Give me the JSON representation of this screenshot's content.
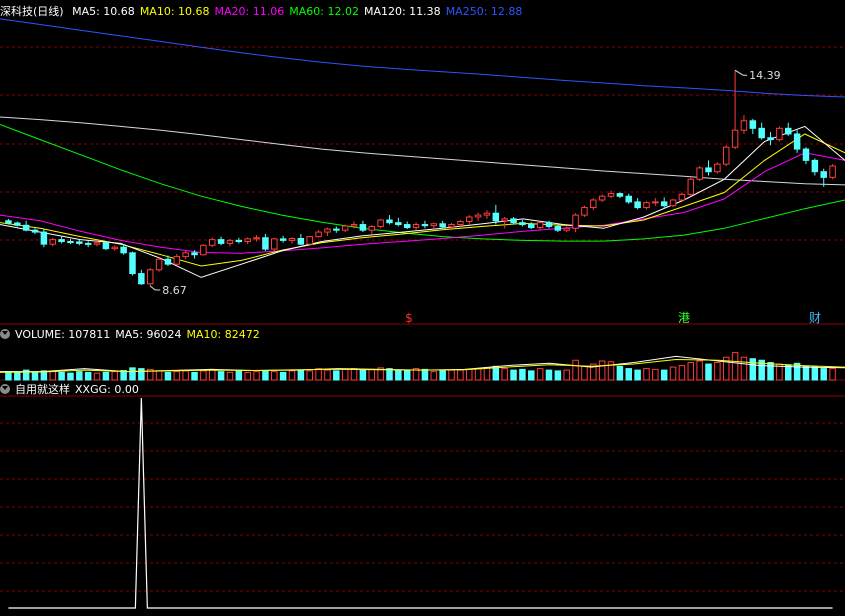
{
  "price_header": {
    "title": "深科技(日线)",
    "items": [
      {
        "label": "MA5: 10.68",
        "color": "#ffffff"
      },
      {
        "label": "MA10: 10.68",
        "color": "#ffff00"
      },
      {
        "label": "MA20: 11.06",
        "color": "#ff00ff"
      },
      {
        "label": "MA60: 12.02",
        "color": "#00ff00"
      },
      {
        "label": "MA120: 11.38",
        "color": "#ffffff"
      },
      {
        "label": "MA250: 12.88",
        "color": "#2e55ff"
      }
    ]
  },
  "volume_header": {
    "items": [
      {
        "label": "VOLUME: 107811",
        "color": "#ffffff"
      },
      {
        "label": "MA5: 96024",
        "color": "#ffffff"
      },
      {
        "label": "MA10: 82472",
        "color": "#ffff00"
      }
    ]
  },
  "indicator_header": {
    "items": [
      {
        "label": "自用就这样",
        "color": "#ffffff"
      },
      {
        "label": "XXGG: 0.00",
        "color": "#ffffff"
      }
    ]
  },
  "annotations": {
    "high_label": "14.39",
    "low_label": "8.67"
  },
  "event_markers": [
    {
      "label": "$",
      "color": "#ff3030"
    },
    {
      "label": "港",
      "color": "#30ff30"
    },
    {
      "label": "财",
      "color": "#3fb8ff"
    }
  ],
  "colors": {
    "up": "#ff3c3c",
    "down": "#54ffff",
    "grid": "#8b0000",
    "background": "#000000"
  },
  "chart_data": [
    {
      "type": "candlestick",
      "title": "深科技(日线)",
      "ylim": [
        8.3,
        15.8
      ],
      "x_index": "trading day index 0-93",
      "candles_ohlc": [
        [
          10.4,
          10.45,
          10.3,
          10.34
        ],
        [
          10.34,
          10.38,
          10.25,
          10.28
        ],
        [
          10.28,
          10.4,
          10.12,
          10.15
        ],
        [
          10.15,
          10.2,
          10.05,
          10.1
        ],
        [
          10.1,
          10.18,
          9.7,
          9.78
        ],
        [
          9.78,
          9.95,
          9.72,
          9.9
        ],
        [
          9.9,
          9.98,
          9.8,
          9.85
        ],
        [
          9.85,
          9.92,
          9.78,
          9.84
        ],
        [
          9.84,
          9.9,
          9.75,
          9.8
        ],
        [
          9.8,
          9.86,
          9.7,
          9.78
        ],
        [
          9.78,
          9.88,
          9.72,
          9.82
        ],
        [
          9.82,
          9.86,
          9.62,
          9.66
        ],
        [
          9.66,
          9.75,
          9.6,
          9.7
        ],
        [
          9.7,
          9.78,
          9.5,
          9.55
        ],
        [
          9.55,
          9.58,
          8.95,
          9.0
        ],
        [
          9.0,
          9.1,
          8.7,
          8.73
        ],
        [
          8.73,
          9.15,
          8.67,
          9.1
        ],
        [
          9.1,
          9.42,
          9.05,
          9.38
        ],
        [
          9.38,
          9.48,
          9.2,
          9.25
        ],
        [
          9.25,
          9.52,
          9.22,
          9.45
        ],
        [
          9.45,
          9.6,
          9.38,
          9.55
        ],
        [
          9.55,
          9.62,
          9.4,
          9.5
        ],
        [
          9.5,
          9.78,
          9.48,
          9.75
        ],
        [
          9.75,
          9.95,
          9.7,
          9.9
        ],
        [
          9.9,
          9.98,
          9.75,
          9.8
        ],
        [
          9.8,
          9.92,
          9.72,
          9.88
        ],
        [
          9.88,
          9.95,
          9.8,
          9.85
        ],
        [
          9.85,
          9.96,
          9.78,
          9.92
        ],
        [
          9.92,
          10.02,
          9.85,
          9.95
        ],
        [
          9.95,
          10.05,
          9.6,
          9.65
        ],
        [
          9.65,
          9.95,
          9.6,
          9.92
        ],
        [
          9.92,
          10.0,
          9.82,
          9.88
        ],
        [
          9.88,
          9.96,
          9.8,
          9.93
        ],
        [
          9.93,
          10.05,
          9.75,
          9.78
        ],
        [
          9.78,
          10.0,
          9.75,
          9.98
        ],
        [
          9.98,
          10.15,
          9.95,
          10.1
        ],
        [
          10.1,
          10.22,
          10.0,
          10.18
        ],
        [
          10.18,
          10.25,
          10.08,
          10.15
        ],
        [
          10.15,
          10.3,
          10.1,
          10.26
        ],
        [
          10.26,
          10.38,
          10.2,
          10.3
        ],
        [
          10.3,
          10.4,
          10.1,
          10.15
        ],
        [
          10.15,
          10.28,
          10.05,
          10.25
        ],
        [
          10.25,
          10.45,
          10.2,
          10.42
        ],
        [
          10.42,
          10.55,
          10.3,
          10.35
        ],
        [
          10.35,
          10.48,
          10.25,
          10.3
        ],
        [
          10.3,
          10.38,
          10.18,
          10.22
        ],
        [
          10.22,
          10.36,
          10.15,
          10.3
        ],
        [
          10.3,
          10.4,
          10.2,
          10.27
        ],
        [
          10.27,
          10.35,
          10.18,
          10.32
        ],
        [
          10.32,
          10.4,
          10.2,
          10.24
        ],
        [
          10.24,
          10.34,
          10.15,
          10.3
        ],
        [
          10.3,
          10.42,
          10.22,
          10.38
        ],
        [
          10.38,
          10.55,
          10.3,
          10.5
        ],
        [
          10.5,
          10.62,
          10.4,
          10.55
        ],
        [
          10.55,
          10.68,
          10.45,
          10.6
        ],
        [
          10.6,
          10.82,
          10.3,
          10.4
        ],
        [
          10.4,
          10.5,
          10.2,
          10.45
        ],
        [
          10.45,
          10.5,
          10.3,
          10.35
        ],
        [
          10.35,
          10.42,
          10.25,
          10.3
        ],
        [
          10.3,
          10.36,
          10.18,
          10.22
        ],
        [
          10.22,
          10.38,
          10.15,
          10.35
        ],
        [
          10.35,
          10.4,
          10.2,
          10.25
        ],
        [
          10.25,
          10.3,
          10.1,
          10.15
        ],
        [
          10.15,
          10.25,
          10.1,
          10.2
        ],
        [
          10.2,
          10.6,
          10.1,
          10.55
        ],
        [
          10.55,
          10.8,
          10.5,
          10.75
        ],
        [
          10.75,
          11.0,
          10.68,
          10.95
        ],
        [
          10.95,
          11.1,
          10.9,
          11.05
        ],
        [
          11.05,
          11.2,
          11.0,
          11.12
        ],
        [
          11.12,
          11.15,
          11.0,
          11.05
        ],
        [
          11.05,
          11.12,
          10.85,
          10.9
        ],
        [
          10.9,
          11.0,
          10.7,
          10.75
        ],
        [
          10.75,
          10.92,
          10.7,
          10.88
        ],
        [
          10.88,
          11.0,
          10.8,
          10.9
        ],
        [
          10.9,
          11.02,
          10.75,
          10.8
        ],
        [
          10.8,
          10.98,
          10.76,
          10.95
        ],
        [
          10.95,
          11.15,
          10.9,
          11.1
        ],
        [
          11.1,
          11.55,
          11.05,
          11.5
        ],
        [
          11.5,
          11.85,
          11.45,
          11.8
        ],
        [
          11.8,
          12.0,
          11.6,
          11.7
        ],
        [
          11.7,
          11.95,
          11.65,
          11.9
        ],
        [
          11.9,
          12.4,
          11.85,
          12.35
        ],
        [
          12.35,
          14.39,
          12.3,
          12.8
        ],
        [
          12.8,
          13.2,
          12.7,
          13.05
        ],
        [
          13.05,
          13.1,
          12.7,
          12.85
        ],
        [
          12.85,
          13.0,
          12.55,
          12.6
        ],
        [
          12.6,
          12.75,
          12.4,
          12.55
        ],
        [
          12.55,
          12.9,
          12.5,
          12.85
        ],
        [
          12.85,
          13.0,
          12.65,
          12.7
        ],
        [
          12.7,
          12.8,
          12.2,
          12.3
        ],
        [
          12.3,
          12.35,
          11.9,
          12.0
        ],
        [
          12.0,
          12.05,
          11.6,
          11.7
        ],
        [
          11.7,
          11.78,
          11.3,
          11.55
        ],
        [
          11.55,
          11.9,
          11.5,
          11.85
        ]
      ],
      "ma_series": [
        {
          "name": "MA120",
          "color": "#d8d8d8",
          "values": [
            13.15,
            13.08,
            13.0,
            12.9,
            12.8,
            12.68,
            12.55,
            12.42,
            12.3,
            12.2,
            12.12,
            12.04,
            11.96,
            11.88,
            11.8,
            11.72,
            11.65,
            11.58,
            11.5,
            11.44,
            11.38,
            11.35
          ]
        },
        {
          "name": "MA250",
          "color": "#2e55ff",
          "values": [
            15.75,
            15.6,
            15.45,
            15.3,
            15.15,
            15.0,
            14.85,
            14.72,
            14.6,
            14.5,
            14.42,
            14.35,
            14.28,
            14.2,
            14.12,
            14.05,
            13.98,
            13.92,
            13.86,
            13.78,
            13.72,
            13.68
          ]
        },
        {
          "name": "MA60",
          "color": "#00ff00",
          "values": [
            12.95,
            12.55,
            12.15,
            11.75,
            11.38,
            11.05,
            10.78,
            10.55,
            10.36,
            10.2,
            10.08,
            9.98,
            9.92,
            9.88,
            9.86,
            9.86,
            9.92,
            10.02,
            10.2,
            10.46,
            10.72,
            10.95
          ]
        },
        {
          "name": "MA20",
          "color": "#ff00ff",
          "values": [
            10.55,
            10.4,
            10.12,
            9.88,
            9.7,
            9.56,
            9.54,
            9.6,
            9.68,
            9.78,
            9.85,
            9.93,
            10.02,
            10.12,
            10.2,
            10.28,
            10.45,
            10.62,
            10.98,
            11.7,
            12.2,
            12.0
          ]
        },
        {
          "name": "MA10",
          "color": "#ffff00",
          "values": [
            10.35,
            10.2,
            9.98,
            9.78,
            9.5,
            9.2,
            9.35,
            9.62,
            9.82,
            9.95,
            10.05,
            10.16,
            10.25,
            10.33,
            10.28,
            10.26,
            10.42,
            10.78,
            11.15,
            12.0,
            12.7,
            12.2
          ]
        },
        {
          "name": "MA5",
          "color": "#ffffff",
          "values": [
            10.3,
            10.1,
            9.9,
            9.8,
            9.4,
            8.9,
            9.25,
            9.6,
            9.85,
            10.0,
            10.1,
            10.2,
            10.32,
            10.45,
            10.3,
            10.2,
            10.5,
            10.95,
            11.5,
            12.5,
            12.9,
            12.0
          ]
        }
      ]
    },
    {
      "type": "bar",
      "title": "VOLUME",
      "values_relative": [
        0.22,
        0.2,
        0.26,
        0.2,
        0.24,
        0.22,
        0.2,
        0.18,
        0.22,
        0.2,
        0.18,
        0.2,
        0.22,
        0.25,
        0.32,
        0.3,
        0.28,
        0.24,
        0.2,
        0.22,
        0.24,
        0.2,
        0.24,
        0.28,
        0.22,
        0.2,
        0.24,
        0.2,
        0.22,
        0.24,
        0.22,
        0.2,
        0.24,
        0.26,
        0.24,
        0.3,
        0.26,
        0.24,
        0.28,
        0.3,
        0.26,
        0.28,
        0.32,
        0.3,
        0.26,
        0.24,
        0.3,
        0.28,
        0.22,
        0.24,
        0.26,
        0.26,
        0.28,
        0.3,
        0.32,
        0.36,
        0.3,
        0.26,
        0.28,
        0.24,
        0.3,
        0.26,
        0.24,
        0.26,
        0.52,
        0.36,
        0.42,
        0.5,
        0.48,
        0.36,
        0.3,
        0.26,
        0.3,
        0.28,
        0.26,
        0.34,
        0.38,
        0.46,
        0.5,
        0.42,
        0.46,
        0.6,
        0.72,
        0.6,
        0.56,
        0.52,
        0.46,
        0.42,
        0.4,
        0.44,
        0.36,
        0.34,
        0.3,
        0.3
      ],
      "lines": [
        {
          "name": "MA5",
          "color": "#ffffff",
          "values_relative": [
            0.22,
            0.22,
            0.3,
            0.22,
            0.25,
            0.28,
            0.25,
            0.26,
            0.3,
            0.28,
            0.26,
            0.28,
            0.38,
            0.44,
            0.34,
            0.46,
            0.62,
            0.5,
            0.38,
            0.34,
            0.32
          ]
        },
        {
          "name": "MA10",
          "color": "#ffff00",
          "values_relative": [
            0.2,
            0.21,
            0.26,
            0.22,
            0.24,
            0.26,
            0.25,
            0.27,
            0.28,
            0.27,
            0.26,
            0.27,
            0.34,
            0.4,
            0.36,
            0.42,
            0.54,
            0.52,
            0.44,
            0.38,
            0.34
          ]
        }
      ]
    },
    {
      "type": "line",
      "title": "XXGG",
      "values": [
        0,
        0,
        0,
        0,
        0,
        0,
        0,
        0,
        0,
        0,
        0,
        0,
        0,
        0,
        0,
        1,
        0,
        0,
        0,
        0,
        0,
        0,
        0,
        0,
        0,
        0,
        0,
        0,
        0,
        0,
        0,
        0,
        0,
        0,
        0,
        0,
        0,
        0,
        0,
        0,
        0,
        0,
        0,
        0,
        0,
        0,
        0,
        0,
        0,
        0,
        0,
        0,
        0,
        0,
        0,
        0,
        0,
        0,
        0,
        0,
        0,
        0,
        0,
        0,
        0,
        0,
        0,
        0,
        0,
        0,
        0,
        0,
        0,
        0,
        0,
        0,
        0,
        0,
        0,
        0,
        0,
        0,
        0,
        0,
        0,
        0,
        0,
        0,
        0,
        0,
        0,
        0,
        0,
        0
      ]
    }
  ]
}
